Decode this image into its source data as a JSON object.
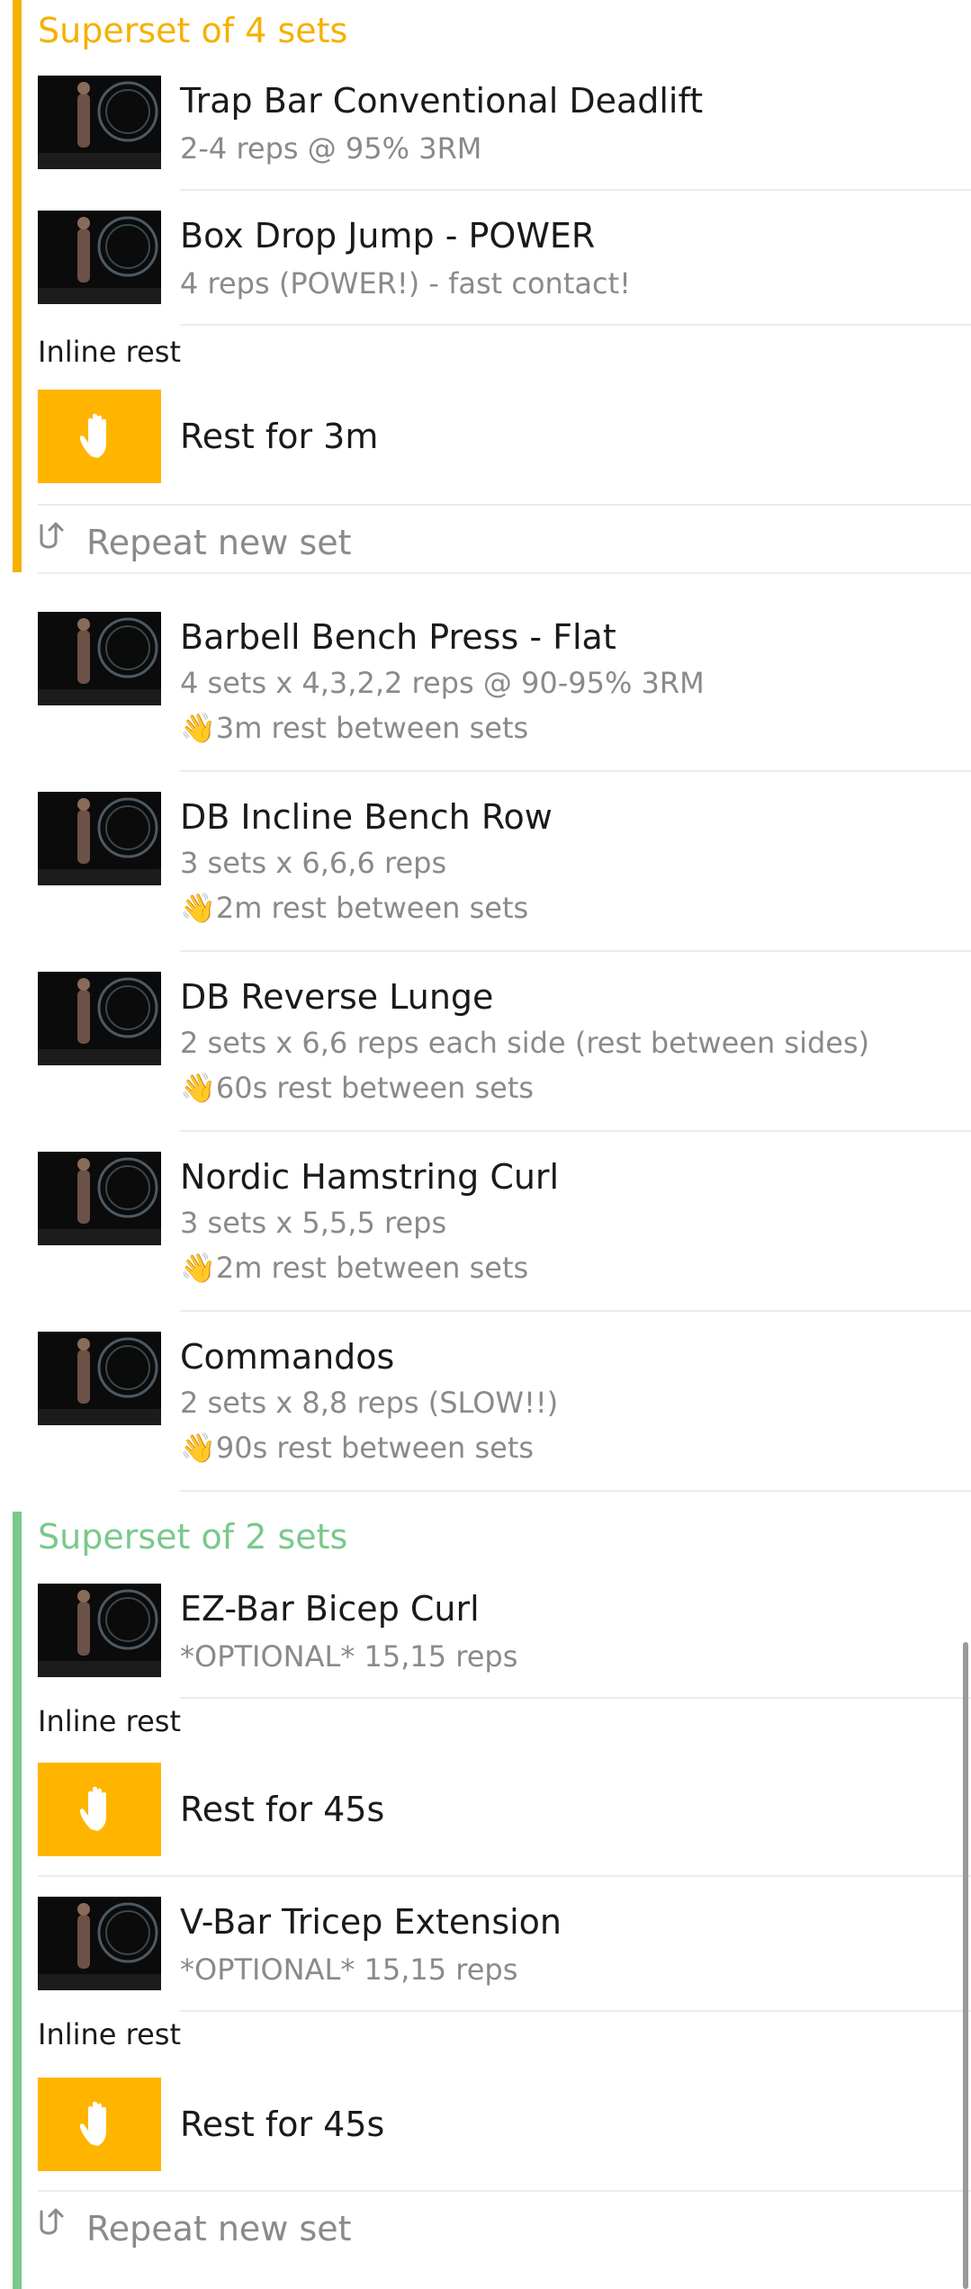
{
  "colors": {
    "superset1": "#f5b100",
    "superset2": "#79c98a",
    "rest_box": "#ffb400",
    "hand": "#f5a800"
  },
  "superset1": {
    "title": "Superset of 4 sets",
    "exercises": [
      {
        "title": "Trap Bar Conventional Deadlift",
        "sub": "2-4 reps @ 95% 3RM"
      },
      {
        "title": "Box Drop Jump - POWER",
        "sub": "4 reps (POWER!) - fast contact!"
      }
    ],
    "inline_rest_label": "Inline rest",
    "rest_text": "Rest for 3m",
    "repeat_label": "Repeat new set"
  },
  "exercises": [
    {
      "title": "Barbell Bench Press - Flat",
      "sub": "4 sets x 4,3,2,2 reps @ 90-95% 3RM",
      "rest": "3m rest between sets"
    },
    {
      "title": "DB Incline Bench Row",
      "sub": "3 sets x 6,6,6 reps",
      "rest": "2m rest between sets"
    },
    {
      "title": "DB Reverse Lunge",
      "sub": "2 sets x 6,6 reps each side (rest between sides)",
      "rest": "60s rest between sets"
    },
    {
      "title": "Nordic Hamstring Curl",
      "sub": "3 sets x 5,5,5 reps",
      "rest": "2m rest between sets"
    },
    {
      "title": "Commandos",
      "sub": "2 sets x 8,8 reps (SLOW!!)",
      "rest": "90s rest between sets"
    }
  ],
  "superset2": {
    "title": "Superset of 2 sets",
    "exercises": [
      {
        "title": "EZ-Bar Bicep Curl",
        "sub": "*OPTIONAL* 15,15 reps"
      },
      {
        "title": "V-Bar Tricep Extension",
        "sub": "*OPTIONAL* 15,15 reps"
      }
    ],
    "inline_rest_label": "Inline rest",
    "rest_text": "Rest for 45s",
    "repeat_label": "Repeat new set"
  },
  "icons": {
    "rest": "hand-icon",
    "repeat": "repeat-arrow-icon",
    "hand_glyph": "👋"
  }
}
